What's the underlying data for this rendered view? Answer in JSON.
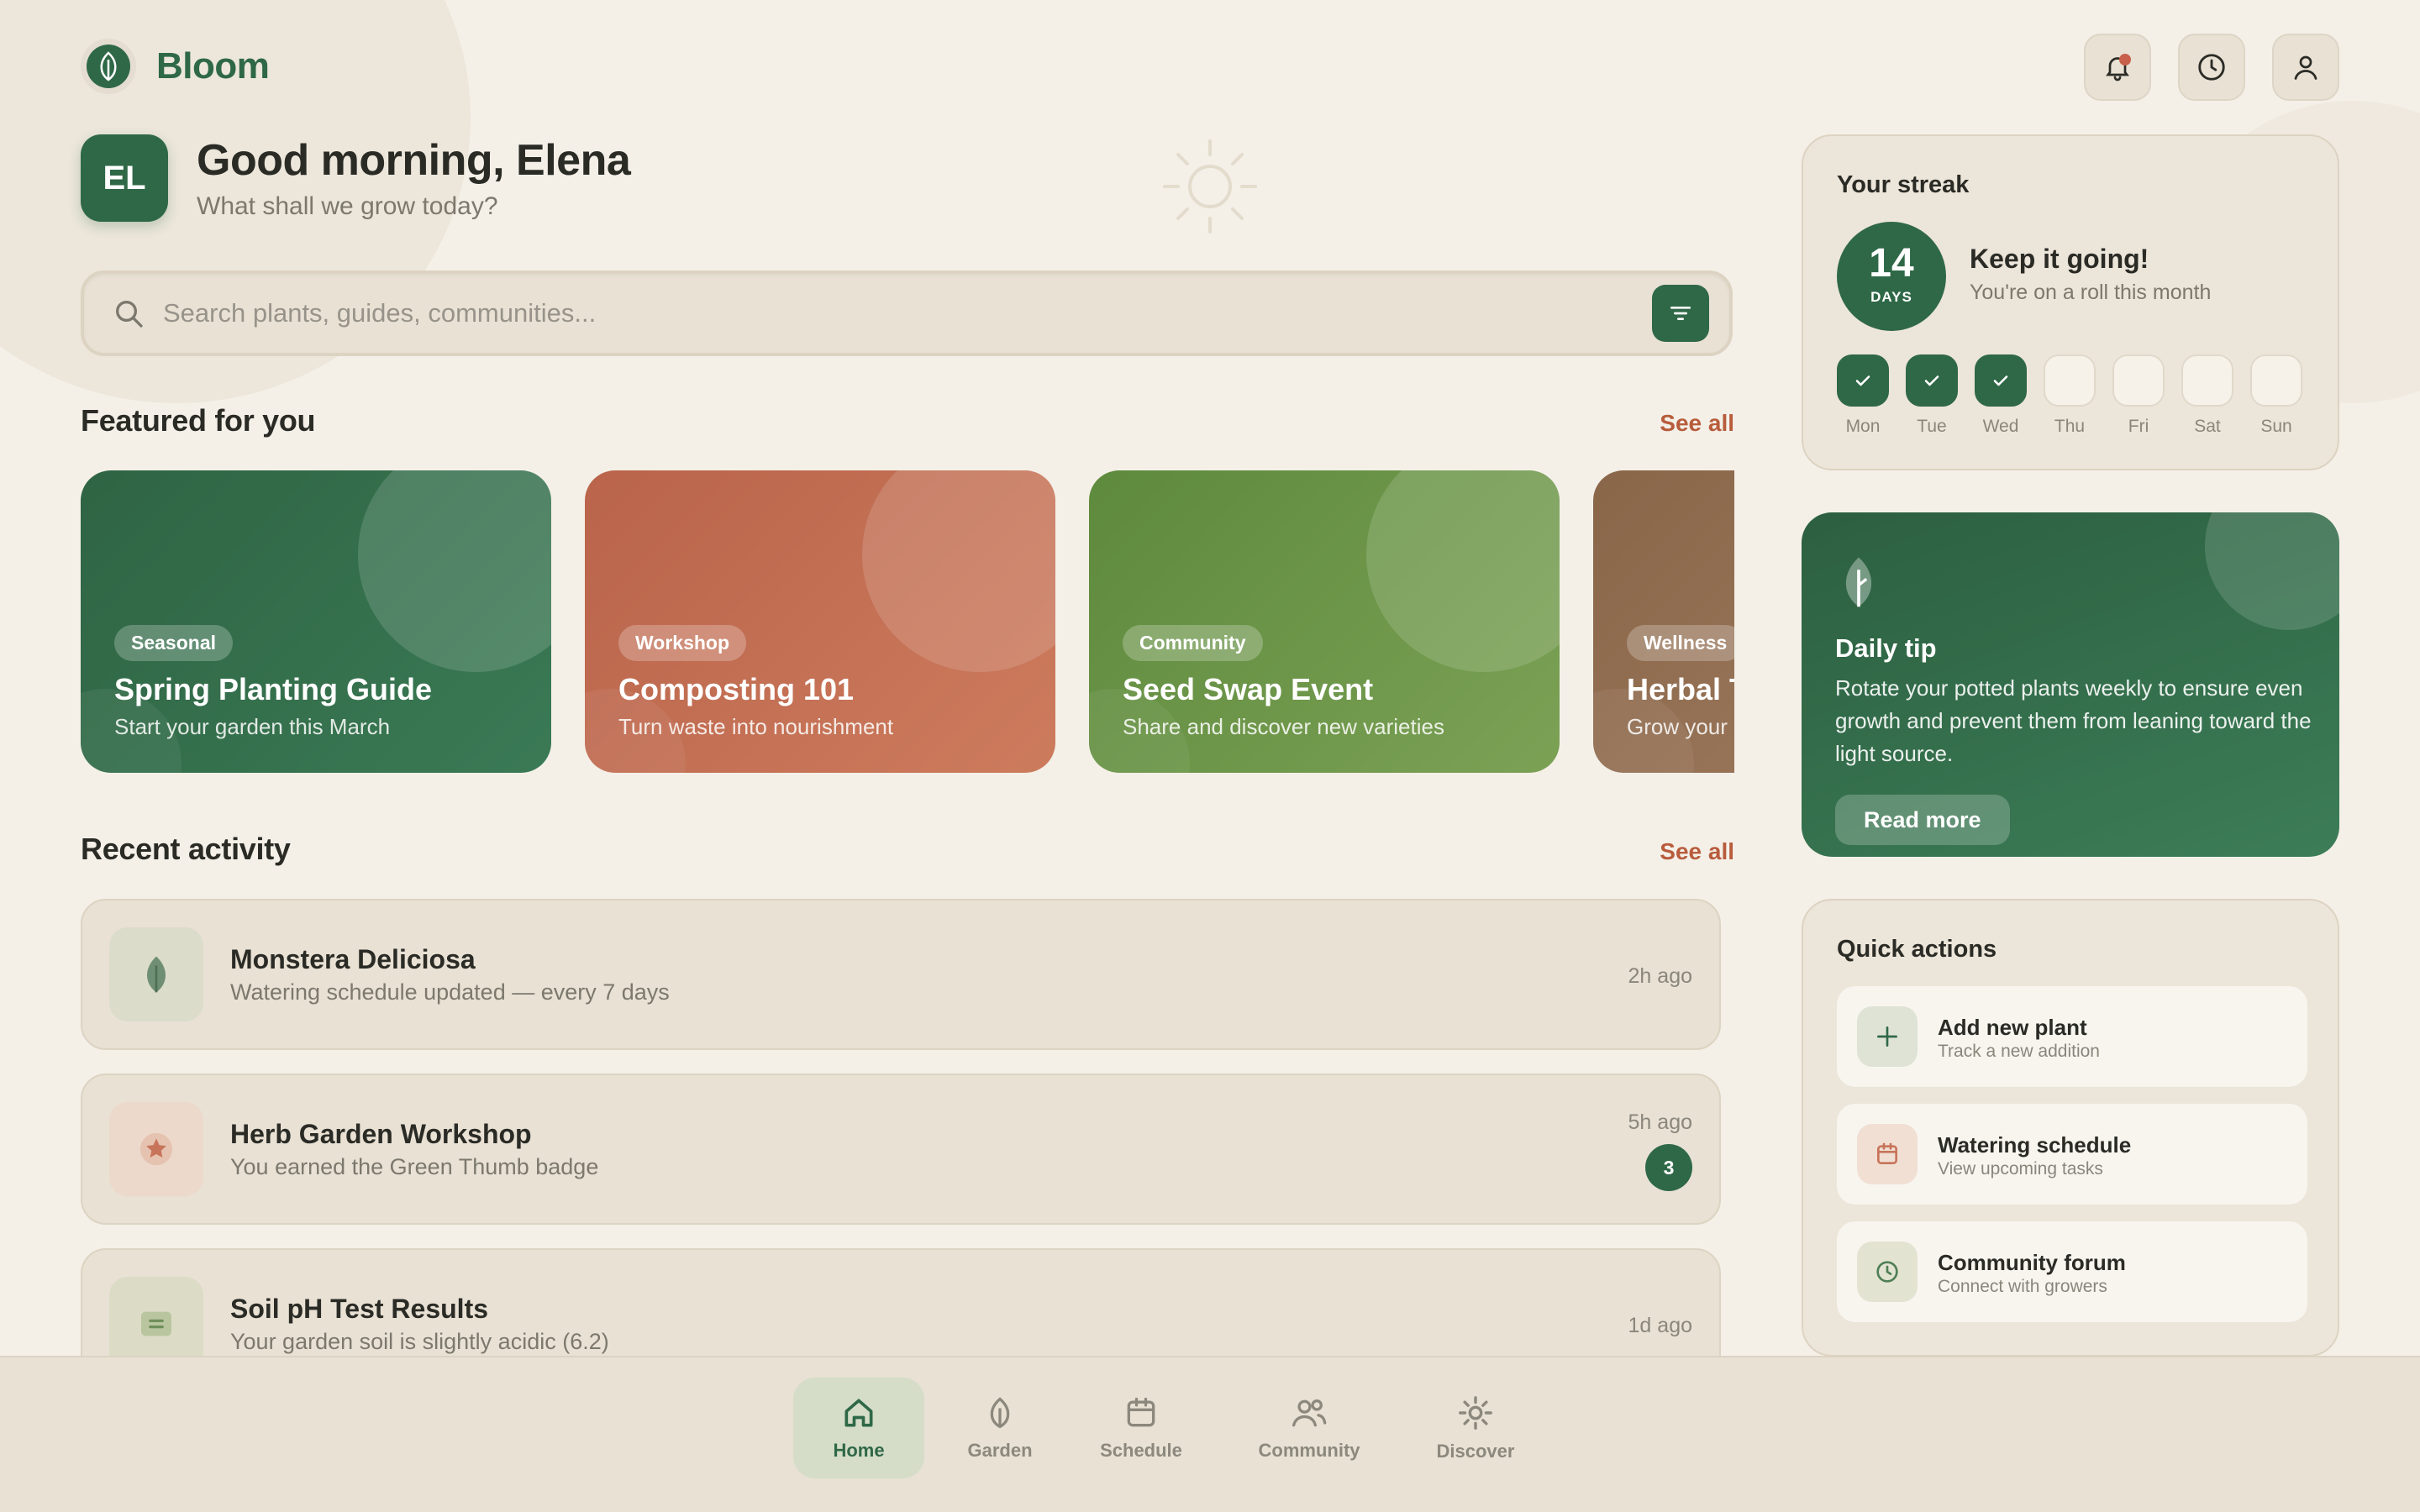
{
  "app": {
    "name": "Bloom"
  },
  "greeting": {
    "initials": "EL",
    "title": "Good morning, Elena",
    "subtitle": "What shall we grow today?"
  },
  "search": {
    "placeholder": "Search plants, guides, communities...",
    "value": ""
  },
  "featured": {
    "title": "Featured for you",
    "see_all": "See all",
    "cards": [
      {
        "tag": "Seasonal",
        "title": "Spring Planting Guide",
        "subtitle": "Start your garden this March"
      },
      {
        "tag": "Workshop",
        "title": "Composting 101",
        "subtitle": "Turn waste into nourishment"
      },
      {
        "tag": "Community",
        "title": "Seed Swap Event",
        "subtitle": "Share and discover new varieties"
      },
      {
        "tag": "Wellness",
        "title": "Herbal T",
        "subtitle": "Grow your"
      }
    ]
  },
  "activity": {
    "title": "Recent activity",
    "see_all": "See all",
    "items": [
      {
        "title": "Monstera Deliciosa",
        "subtitle": "Watering schedule updated — every 7 days",
        "time": "2h ago",
        "icon": "leaf-icon"
      },
      {
        "title": "Herb Garden Workshop",
        "subtitle": "You earned the Green Thumb badge",
        "time": "5h ago",
        "badge": "3",
        "icon": "star-icon"
      },
      {
        "title": "Soil pH Test Results",
        "subtitle": "Your garden soil is slightly acidic (6.2)",
        "time": "1d ago",
        "icon": "report-icon"
      }
    ]
  },
  "streak": {
    "title": "Your streak",
    "count": "14",
    "unit": "DAYS",
    "headline": "Keep it going!",
    "subtitle": "You're on a roll this month",
    "days": [
      {
        "label": "Mon",
        "done": true
      },
      {
        "label": "Tue",
        "done": true
      },
      {
        "label": "Wed",
        "done": true
      },
      {
        "label": "Thu",
        "done": false
      },
      {
        "label": "Fri",
        "done": false
      },
      {
        "label": "Sat",
        "done": false
      },
      {
        "label": "Sun",
        "done": false
      }
    ]
  },
  "tip": {
    "title": "Daily tip",
    "text": "Rotate your potted plants weekly to ensure even growth and prevent them from leaning toward the light source.",
    "button": "Read more"
  },
  "quick_actions": {
    "title": "Quick actions",
    "items": [
      {
        "title": "Add new plant",
        "subtitle": "Track a new addition",
        "icon": "plus-icon"
      },
      {
        "title": "Watering schedule",
        "subtitle": "View upcoming tasks",
        "icon": "calendar-icon"
      },
      {
        "title": "Community forum",
        "subtitle": "Connect with growers",
        "icon": "clock-icon"
      }
    ]
  },
  "nav": {
    "items": [
      {
        "label": "Home",
        "icon": "home-icon",
        "active": true
      },
      {
        "label": "Garden",
        "icon": "leaf-icon",
        "active": false
      },
      {
        "label": "Schedule",
        "icon": "calendar-icon",
        "active": false
      },
      {
        "label": "Community",
        "icon": "people-icon",
        "active": false
      },
      {
        "label": "Discover",
        "icon": "sun-icon",
        "active": false
      }
    ]
  },
  "colors": {
    "primary": "#2f6847",
    "accent": "#b85c3c",
    "background": "#f4f0e8",
    "surface": "#e8e1d4"
  }
}
